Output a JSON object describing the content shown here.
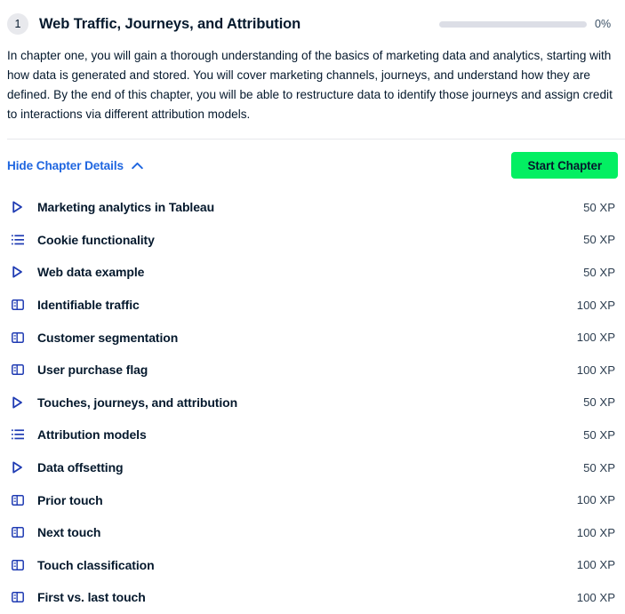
{
  "chapter": {
    "number": "1",
    "title": "Web Traffic, Journeys, and Attribution",
    "description": "In chapter one, you will gain a thorough understanding of the basics of marketing data and analytics, starting with how data is generated and stored. You will cover marketing channels, journeys, and understand how they are defined. By the end of this chapter, you will be able to restructure data to identify those journeys and assign credit to interactions via different attribution models.",
    "progress_percent": 0,
    "progress_label": "0%"
  },
  "controls": {
    "toggle_details_label": "Hide Chapter Details",
    "toggle_icon": "chevron-up-icon",
    "start_button_label": "Start Chapter"
  },
  "colors": {
    "accent_green": "#03ef62",
    "link_blue": "#1f66e0",
    "text_navy": "#05192d",
    "icon_blue": "#1f3bb3",
    "progress_track": "#dcdee6",
    "divider": "#e7e8ec",
    "badge_bg": "#e8e9ed"
  },
  "exercises": [
    {
      "icon": "play-icon",
      "type": "video",
      "label": "Marketing analytics in Tableau",
      "xp": "50 XP"
    },
    {
      "icon": "list-icon",
      "type": "exercise",
      "label": "Cookie functionality",
      "xp": "50 XP"
    },
    {
      "icon": "play-icon",
      "type": "video",
      "label": "Web data example",
      "xp": "50 XP"
    },
    {
      "icon": "split-pane-icon",
      "type": "lab",
      "label": "Identifiable traffic",
      "xp": "100 XP"
    },
    {
      "icon": "split-pane-icon",
      "type": "lab",
      "label": "Customer segmentation",
      "xp": "100 XP"
    },
    {
      "icon": "split-pane-icon",
      "type": "lab",
      "label": "User purchase flag",
      "xp": "100 XP"
    },
    {
      "icon": "play-icon",
      "type": "video",
      "label": "Touches, journeys, and attribution",
      "xp": "50 XP"
    },
    {
      "icon": "list-icon",
      "type": "exercise",
      "label": "Attribution models",
      "xp": "50 XP"
    },
    {
      "icon": "play-icon",
      "type": "video",
      "label": "Data offsetting",
      "xp": "50 XP"
    },
    {
      "icon": "split-pane-icon",
      "type": "lab",
      "label": "Prior touch",
      "xp": "100 XP"
    },
    {
      "icon": "split-pane-icon",
      "type": "lab",
      "label": "Next touch",
      "xp": "100 XP"
    },
    {
      "icon": "split-pane-icon",
      "type": "lab",
      "label": "Touch classification",
      "xp": "100 XP"
    },
    {
      "icon": "split-pane-icon",
      "type": "lab",
      "label": "First vs. last touch",
      "xp": "100 XP"
    }
  ]
}
